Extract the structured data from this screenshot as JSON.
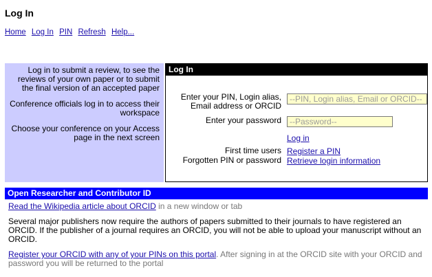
{
  "page": {
    "title": "Log In"
  },
  "nav": {
    "items": [
      "Home",
      "Log In",
      "PIN",
      "Refresh",
      "Help..."
    ]
  },
  "info": {
    "para1": "Log in to submit a review, to see the reviews of your own paper or to submit the final version of an accepted paper",
    "para2": "Conference officials log in to access their workspace",
    "para3": "Choose your conference on your Access page in the next screen"
  },
  "login": {
    "header": "Log In",
    "pin_label_line1": "Enter your PIN, Login alias,",
    "pin_label_line2": "Email address or ORCID",
    "pin_placeholder": "--PIN, Login alias, Email or ORCID--",
    "password_label": "Enter your password",
    "password_placeholder": "--Password--",
    "login_link": "Log in",
    "first_time_label": "First time users",
    "register_link": "Register a PIN",
    "forgot_label": "Forgotten PIN or password",
    "retrieve_link": "Retrieve login information"
  },
  "orcid": {
    "header": "Open Researcher and Contributor ID",
    "wiki_link": "Read the Wikipedia article about ORCID",
    "wiki_suffix": " in a new window or tab",
    "notice": "Several major publishers now require the authors of papers submitted to their journals to have registered an ORCID. If the publisher of a journal requires an ORCID, you will not be able to upload your manuscript without an ORCID.",
    "register_link": "Register your ORCID with any of your PINs on this portal",
    "register_suffix": ". After signing in at the ORCID site with your ORCID and password you will be returned to the portal"
  }
}
